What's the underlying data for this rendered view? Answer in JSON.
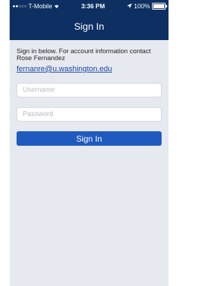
{
  "status_bar": {
    "carrier": "T-Mobile",
    "time": "3:36 PM",
    "battery": "100%",
    "battery_level": 1.0
  },
  "nav": {
    "title": "Sign In"
  },
  "info": {
    "text": "Sign in below. For account information contact Rose Fernandez",
    "email": "fernanre@u.washington.edu"
  },
  "form": {
    "username_placeholder": "Username",
    "password_placeholder": "Password",
    "submit_label": "Sign In"
  },
  "colors": {
    "nav_background": "#0d2f62",
    "button": "#1f5bbf",
    "link": "#1c46a6",
    "background": "#e6e9ef"
  }
}
